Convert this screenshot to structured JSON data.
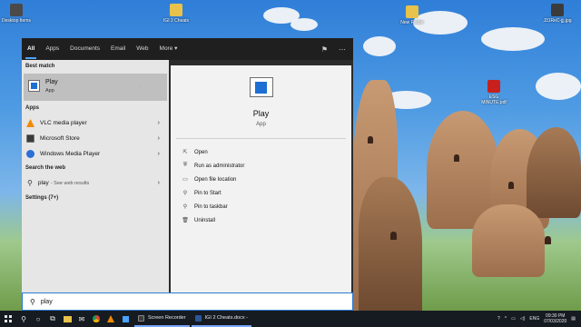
{
  "desktop": {
    "icons": [
      {
        "label": "Desktop Items",
        "color": "#4a4a4a"
      },
      {
        "label": "IGI 2 Cheats",
        "color": "#e8c24a"
      },
      {
        "label": "New Folder",
        "color": "#e8c24a"
      },
      {
        "label": "J31ReC-jjj.jpg",
        "color": "#3b3b3b"
      },
      {
        "label": "ESG MINUTE.pdf",
        "color": "#c8201c"
      }
    ]
  },
  "start_menu": {
    "tabs": [
      {
        "label": "All",
        "active": true
      },
      {
        "label": "Apps",
        "active": false
      },
      {
        "label": "Documents",
        "active": false
      },
      {
        "label": "Email",
        "active": false
      },
      {
        "label": "Web",
        "active": false
      },
      {
        "label": "More ▾",
        "active": false
      }
    ],
    "best_match": {
      "heading": "Best match",
      "title": "Play",
      "subtitle": "App"
    },
    "apps": {
      "heading": "Apps",
      "items": [
        {
          "label": "VLC media player",
          "icon": "vlc-icon",
          "color": "#f08a00"
        },
        {
          "label": "Microsoft Store",
          "icon": "store-icon",
          "color": "#3a3a3a"
        },
        {
          "label": "Windows Media Player",
          "icon": "media-player-icon",
          "color": "#2c6fd6"
        }
      ]
    },
    "web": {
      "heading": "Search the web",
      "query": "play",
      "suffix": "- See web results"
    },
    "settings": {
      "heading": "Settings (7+)"
    },
    "preview": {
      "title": "Play",
      "subtitle": "App",
      "actions": [
        {
          "label": "Open",
          "icon": "open-icon",
          "glyph": "⇱"
        },
        {
          "label": "Run as administrator",
          "icon": "shield-icon",
          "glyph": "⛨"
        },
        {
          "label": "Open file location",
          "icon": "folder-icon",
          "glyph": "▭"
        },
        {
          "label": "Pin to Start",
          "icon": "pin-icon",
          "glyph": "⚲"
        },
        {
          "label": "Pin to taskbar",
          "icon": "pin-taskbar-icon",
          "glyph": "⚲"
        },
        {
          "label": "Uninstall",
          "icon": "trash-icon",
          "glyph": "🗑"
        }
      ]
    }
  },
  "search": {
    "value": "play"
  },
  "taskbar": {
    "apps": [
      {
        "label": "Screen Recorder",
        "color": "#3c3c3c"
      },
      {
        "label": "IGI 2 Cheats.docx -",
        "color": "#2b5797"
      }
    ],
    "lang": "ENG",
    "time": "09:30 PM",
    "date": "07/03/2020"
  },
  "colors": {
    "accent": "#4aa3ff",
    "menu_dark": "#2b2b2b",
    "left_panel": "#e6e6e6",
    "right_panel": "#f2f2f2",
    "selected": "#bfbfbf"
  }
}
